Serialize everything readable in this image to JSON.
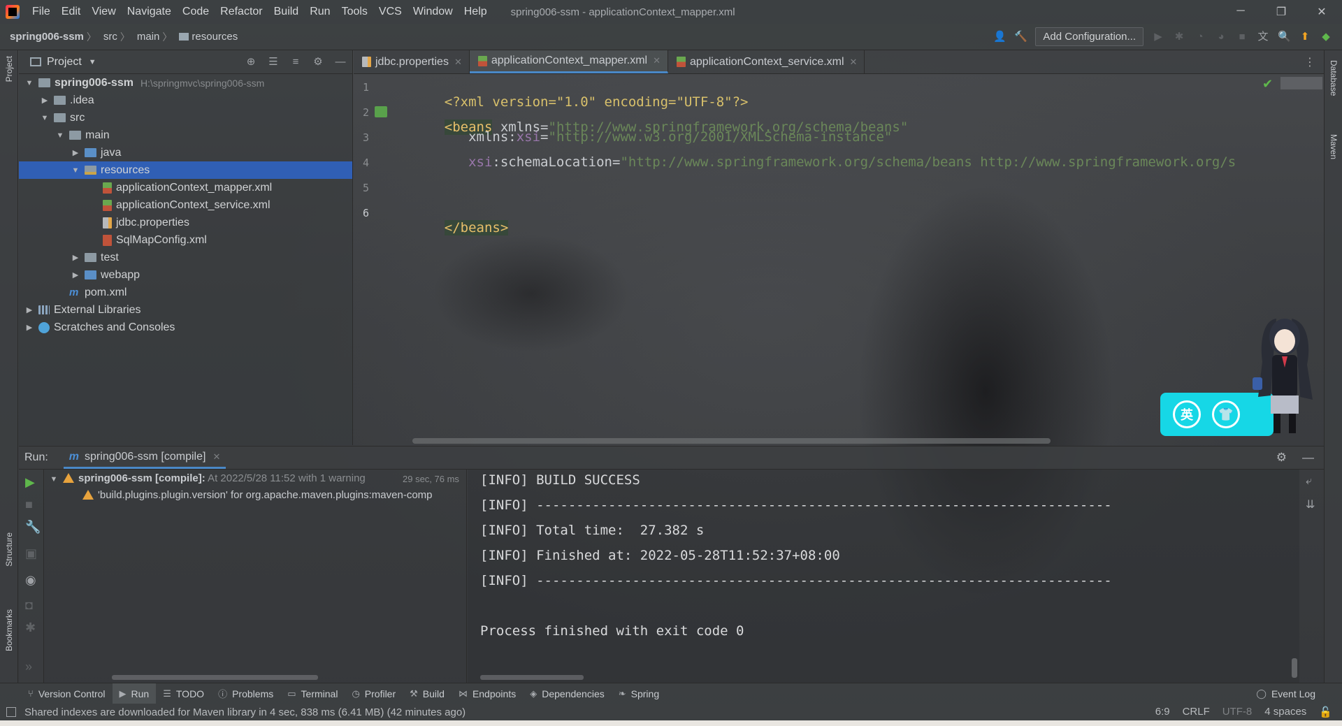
{
  "window": {
    "title": "spring006-ssm - applicationContext_mapper.xml",
    "menu": [
      "File",
      "Edit",
      "View",
      "Navigate",
      "Code",
      "Refactor",
      "Build",
      "Run",
      "Tools",
      "VCS",
      "Window",
      "Help"
    ],
    "controls": [
      "─",
      "❐",
      "✕"
    ]
  },
  "navbar": {
    "breadcrumbs": [
      "spring006-ssm",
      "src",
      "main",
      "resources"
    ],
    "add_configuration": "Add Configuration..."
  },
  "sidebars": {
    "left_top": "Project",
    "left_mid": "Structure",
    "left_bottom": "Bookmarks",
    "right_top": "Database",
    "right_mid": "Maven"
  },
  "project_panel": {
    "title": "Project",
    "tree": [
      {
        "name": "spring006-ssm",
        "path": "H:\\springmvc\\spring006-ssm"
      },
      {
        "name": ".idea"
      },
      {
        "name": "src"
      },
      {
        "name": "main"
      },
      {
        "name": "java"
      },
      {
        "name": "resources"
      },
      {
        "name": "applicationContext_mapper.xml"
      },
      {
        "name": "applicationContext_service.xml"
      },
      {
        "name": "jdbc.properties"
      },
      {
        "name": "SqlMapConfig.xml"
      },
      {
        "name": "test"
      },
      {
        "name": "webapp"
      },
      {
        "name": "pom.xml"
      },
      {
        "name": "External Libraries"
      },
      {
        "name": "Scratches and Consoles"
      }
    ]
  },
  "editor": {
    "tabs": [
      "jdbc.properties",
      "applicationContext_mapper.xml",
      "applicationContext_service.xml"
    ],
    "active_tab": "applicationContext_mapper.xml",
    "line_numbers": [
      "1",
      "2",
      "3",
      "4",
      "5",
      "6"
    ],
    "code": {
      "l1_pi": "<?xml version=\"1.0\" encoding=\"UTF-8\"?>",
      "l2_tag": "<beans",
      "l2_attr": "xmlns=",
      "l2_val": "\"http://www.springframework.org/schema/beans\"",
      "l3_attr": "xmlns:",
      "l3_ns": "xsi",
      "l3_eq": "=",
      "l3_val": "\"http://www.w3.org/2001/XMLSchema-instance\"",
      "l4_ns": "xsi",
      "l4_attr": ":schemaLocation=",
      "l4_val": "\"http://www.springframework.org/schema/beans http://www.springframework.org/s",
      "l6_tag": "</beans>"
    }
  },
  "widget": {
    "btn1": "英",
    "btn2": "👕"
  },
  "run_panel": {
    "label": "Run:",
    "tab": "spring006-ssm [compile]",
    "tree": {
      "root_name": "spring006-ssm [compile]:",
      "root_info": " At 2022/5/28 11:52 with 1 warning",
      "root_time": "29 sec, 76 ms",
      "warning": "'build.plugins.plugin.version' for org.apache.maven.plugins:maven-comp"
    },
    "console": [
      "[INFO] BUILD SUCCESS",
      "[INFO] ------------------------------------------------------------------------",
      "[INFO] Total time:  27.382 s",
      "[INFO] Finished at: 2022-05-28T11:52:37+08:00",
      "[INFO] ------------------------------------------------------------------------",
      "",
      "Process finished with exit code 0"
    ]
  },
  "toolwindows": [
    "Version Control",
    "Run",
    "TODO",
    "Problems",
    "Terminal",
    "Profiler",
    "Build",
    "Endpoints",
    "Dependencies",
    "Spring"
  ],
  "event_log": "Event Log",
  "statusbar": {
    "message": "Shared indexes are downloaded for Maven library in 4 sec, 838 ms (6.41 MB) (42 minutes ago)",
    "position": "6:9",
    "line_sep": "CRLF",
    "encoding": "UTF-8",
    "indent": "4 spaces"
  }
}
